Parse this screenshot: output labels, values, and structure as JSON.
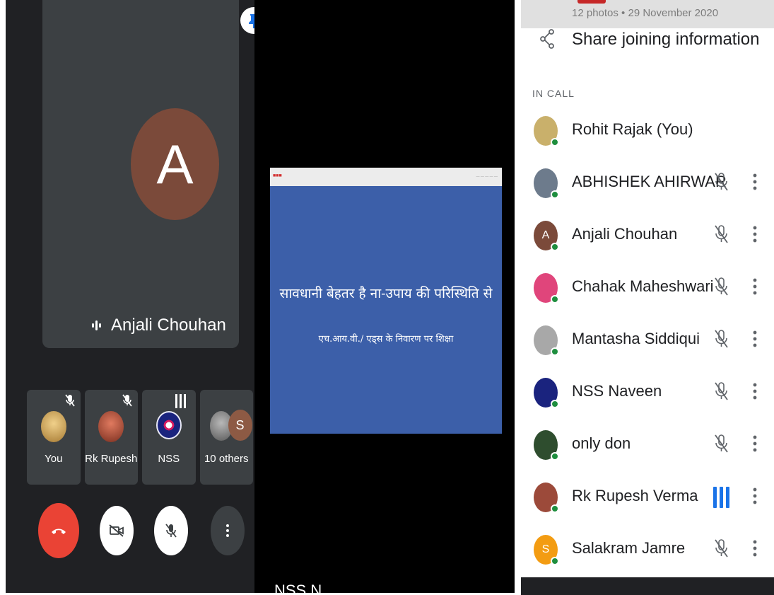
{
  "left": {
    "main_speaker": {
      "initial": "A",
      "name": "Anjali Chouhan"
    },
    "thumbnails": [
      {
        "label": "You",
        "muted": true
      },
      {
        "label": "Rk Rupesh",
        "muted": true
      },
      {
        "label": "NSS",
        "speaking": true
      },
      {
        "label": "10 others",
        "initial": "S"
      }
    ]
  },
  "middle": {
    "slide": {
      "line1": "सावधानी बेहतर है ना-उपाय की परिस्थिति से",
      "line2": "एच.आय.वी./ एड्स के निवारण पर शिक्षा"
    },
    "footer_name": "NSS N"
  },
  "right": {
    "top_info": "12 photos • 29 November 2020",
    "share_label": "Share joining information",
    "section_label": "IN CALL",
    "participants": [
      {
        "name": "Rohit Rajak (You)",
        "avatar_color": "#c9b06b",
        "initial": "",
        "muted": false,
        "speaking": false,
        "show_more": false
      },
      {
        "name": "ABHISHEK AHIRWAR",
        "avatar_color": "#6d7b8c",
        "initial": "",
        "muted": true,
        "speaking": false,
        "show_more": true
      },
      {
        "name": "Anjali Chouhan",
        "avatar_color": "#7b4a3a",
        "initial": "A",
        "muted": true,
        "speaking": false,
        "show_more": true
      },
      {
        "name": "Chahak Maheshwari",
        "avatar_color": "#e0457b",
        "initial": "",
        "muted": true,
        "speaking": false,
        "show_more": true
      },
      {
        "name": "Mantasha Siddiqui",
        "avatar_color": "#a8a8a8",
        "initial": "",
        "muted": true,
        "speaking": false,
        "show_more": true
      },
      {
        "name": "NSS Naveen",
        "avatar_color": "#1a237e",
        "initial": "",
        "muted": true,
        "speaking": false,
        "show_more": true
      },
      {
        "name": "only don",
        "avatar_color": "#2e4d2e",
        "initial": "",
        "muted": true,
        "speaking": false,
        "show_more": true
      },
      {
        "name": "Rk Rupesh Verma",
        "avatar_color": "#9c4a3a",
        "initial": "",
        "muted": false,
        "speaking": true,
        "show_more": true
      },
      {
        "name": "Salakram Jamre",
        "avatar_color": "#f39c12",
        "initial": "S",
        "muted": true,
        "speaking": false,
        "show_more": true
      }
    ]
  },
  "colors": {
    "end_call": "#ea4335",
    "online_dot": "#1e8e3e",
    "speaking_bars": "#1a73e8"
  }
}
